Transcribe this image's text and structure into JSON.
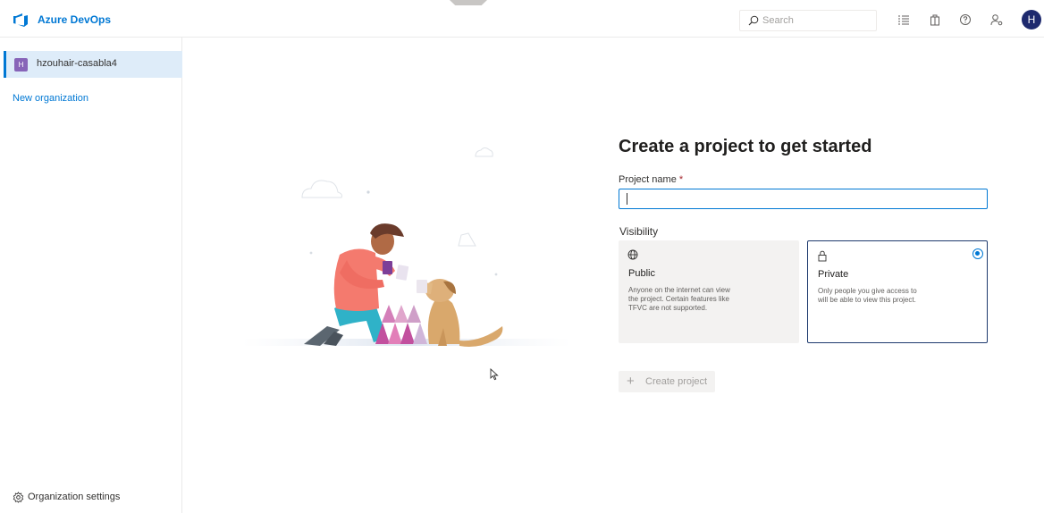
{
  "header": {
    "app_title": "Azure DevOps",
    "search_placeholder": "Search",
    "avatar_initial": "H",
    "brand_color": "#0078d4"
  },
  "sidebar": {
    "organization": {
      "badge": "H",
      "name": "hzouhair-casabla4"
    },
    "new_organization_label": "New organization",
    "settings_label": "Organization settings"
  },
  "main": {
    "heading": "Create a project to get started",
    "project_name_label": "Project name",
    "required_marker": "*",
    "project_name_value": "",
    "visibility_label": "Visibility",
    "visibility_options": [
      {
        "icon": "globe-icon",
        "title": "Public",
        "description": "Anyone on the internet can view the project. Certain features like TFVC are not supported.",
        "selected": false
      },
      {
        "icon": "lock-icon",
        "title": "Private",
        "description": "Only people you give access to will be able to view this project.",
        "selected": true
      }
    ],
    "create_button_label": "Create project"
  }
}
